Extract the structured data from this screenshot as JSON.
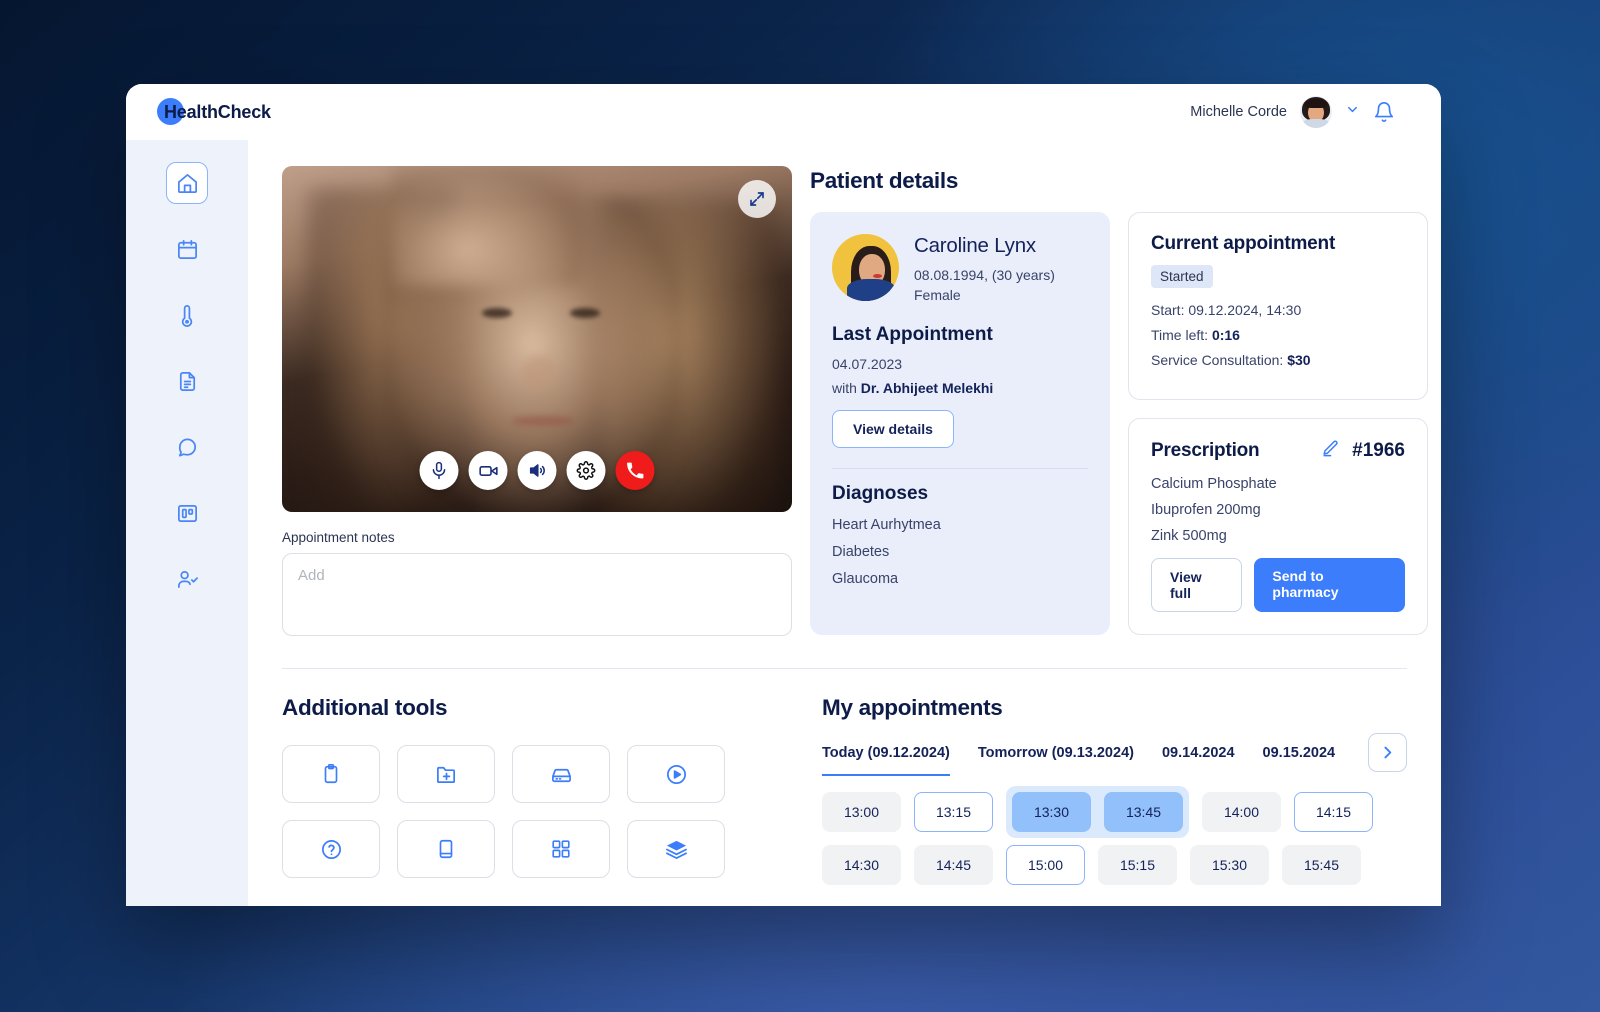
{
  "brand": {
    "name": "HealthCheck"
  },
  "header": {
    "user_name": "Michelle Corde",
    "chevron": "chevron-down-icon",
    "bell": "bell-icon"
  },
  "sidebar": {
    "items": [
      {
        "name": "home",
        "active": true
      },
      {
        "name": "calendar",
        "active": false
      },
      {
        "name": "thermometer",
        "active": false
      },
      {
        "name": "document",
        "active": false
      },
      {
        "name": "chat",
        "active": false
      },
      {
        "name": "board",
        "active": false
      },
      {
        "name": "user-check",
        "active": false
      }
    ]
  },
  "video": {
    "expand_icon": "expand-icon",
    "controls": [
      {
        "name": "microphone",
        "style": "light"
      },
      {
        "name": "camera",
        "style": "light"
      },
      {
        "name": "speaker",
        "style": "light"
      },
      {
        "name": "settings",
        "style": "dark"
      },
      {
        "name": "end-call",
        "style": "end"
      }
    ]
  },
  "notes": {
    "label": "Appointment notes",
    "placeholder": "Add",
    "value": ""
  },
  "patient_details": {
    "title": "Patient details",
    "patient": {
      "name": "Caroline Lynx",
      "birth_and_age": "08.08.1994, (30 years)",
      "gender": "Female"
    },
    "last_appointment": {
      "title": "Last Appointment",
      "date": "04.07.2023",
      "with_prefix": "with ",
      "doctor": "Dr. Abhijeet Melekhi",
      "button": "View details"
    },
    "diagnoses": {
      "title": "Diagnoses",
      "items": [
        "Heart Aurhytmea",
        "Diabetes",
        "Glaucoma"
      ]
    }
  },
  "current_appointment": {
    "title": "Current appointment",
    "status": "Started",
    "start_label": "Start: 09.12.2024, 14:30",
    "time_left_label": "Time left: ",
    "time_left_value": "0:16",
    "service_label": "Service Consultation: ",
    "service_value": "$30"
  },
  "prescription": {
    "title": "Prescription",
    "edit_icon": "pencil-icon",
    "number": "#1966",
    "items": [
      "Calcium Phosphate",
      "Ibuprofen 200mg",
      "Zink 500mg"
    ],
    "view_full_button": "View full",
    "send_button": "Send to pharmacy"
  },
  "additional_tools": {
    "title": "Additional tools",
    "tools": [
      {
        "icon": "clipboard-icon"
      },
      {
        "icon": "folder-plus-icon"
      },
      {
        "icon": "server-icon"
      },
      {
        "icon": "play-circle-icon"
      },
      {
        "icon": "question-circle-icon"
      },
      {
        "icon": "book-icon"
      },
      {
        "icon": "grid-icon"
      },
      {
        "icon": "layers-icon"
      }
    ]
  },
  "my_appointments": {
    "title": "My appointments",
    "tabs": [
      {
        "label": "Today (09.12.2024)",
        "active": true
      },
      {
        "label": "Tomorrow (09.13.2024)",
        "active": false
      },
      {
        "label": "09.14.2024",
        "active": false
      },
      {
        "label": "09.15.2024",
        "active": false
      }
    ],
    "next_icon": "chevron-right-icon",
    "rows": [
      [
        {
          "time": "13:00",
          "state": "free"
        },
        {
          "time": "13:15",
          "state": "outlined"
        },
        {
          "time": "13:30",
          "state": "selected"
        },
        {
          "time": "13:45",
          "state": "selected"
        },
        {
          "time": "14:00",
          "state": "free"
        },
        {
          "time": "14:15",
          "state": "outlined"
        }
      ],
      [
        {
          "time": "14:30",
          "state": "free"
        },
        {
          "time": "14:45",
          "state": "free"
        },
        {
          "time": "15:00",
          "state": "outlined"
        },
        {
          "time": "15:15",
          "state": "free"
        },
        {
          "time": "15:30",
          "state": "free"
        },
        {
          "time": "15:45",
          "state": "free"
        }
      ]
    ]
  },
  "colors": {
    "accent": "#3b7dfb",
    "navy": "#0d1b48",
    "sidebar_bg": "#eef2fb",
    "card_bg": "#e9eefa",
    "danger": "#f01b1b",
    "slot_selected": "#92c0fb",
    "slot_free": "#f1f2f4"
  }
}
